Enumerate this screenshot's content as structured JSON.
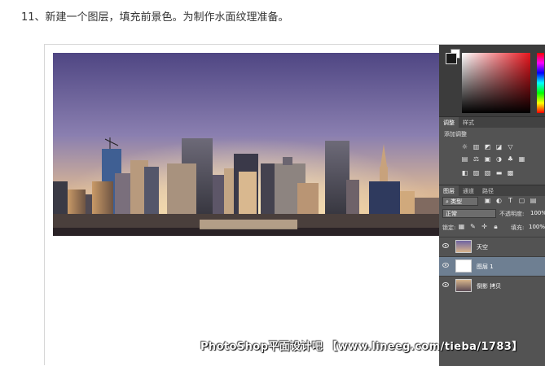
{
  "caption": "11、新建一个图层，填充前景色。为制作水面纹理准备。",
  "watermark": "PhotoShop平面设计吧 【www.lineeg.com/tieba/1783】",
  "panel": {
    "tabs_adjust": [
      "调整",
      "样式"
    ],
    "adjust_title": "添加调整",
    "tabs_layers": [
      "图层",
      "通道",
      "路径"
    ],
    "filter_kind": "类型",
    "blend_mode": "正常",
    "opacity_label": "不透明度:",
    "opacity_value": "100%",
    "lock_label": "锁定:",
    "fill_label": "填充:",
    "fill_value": "100%",
    "layers": [
      {
        "name": "天空",
        "selected": false,
        "thumb": "sky"
      },
      {
        "name": "图层 1",
        "selected": true,
        "thumb": "white"
      },
      {
        "name": "倒影 拷贝",
        "selected": false,
        "thumb": "reflection"
      }
    ]
  },
  "colors": {
    "panel_bg": "#535353",
    "selected_layer": "#6e7f92",
    "sky_top": "#5a4e86",
    "sky_glow": "#f3c68a",
    "foreground_color": "#1a1a1a"
  }
}
